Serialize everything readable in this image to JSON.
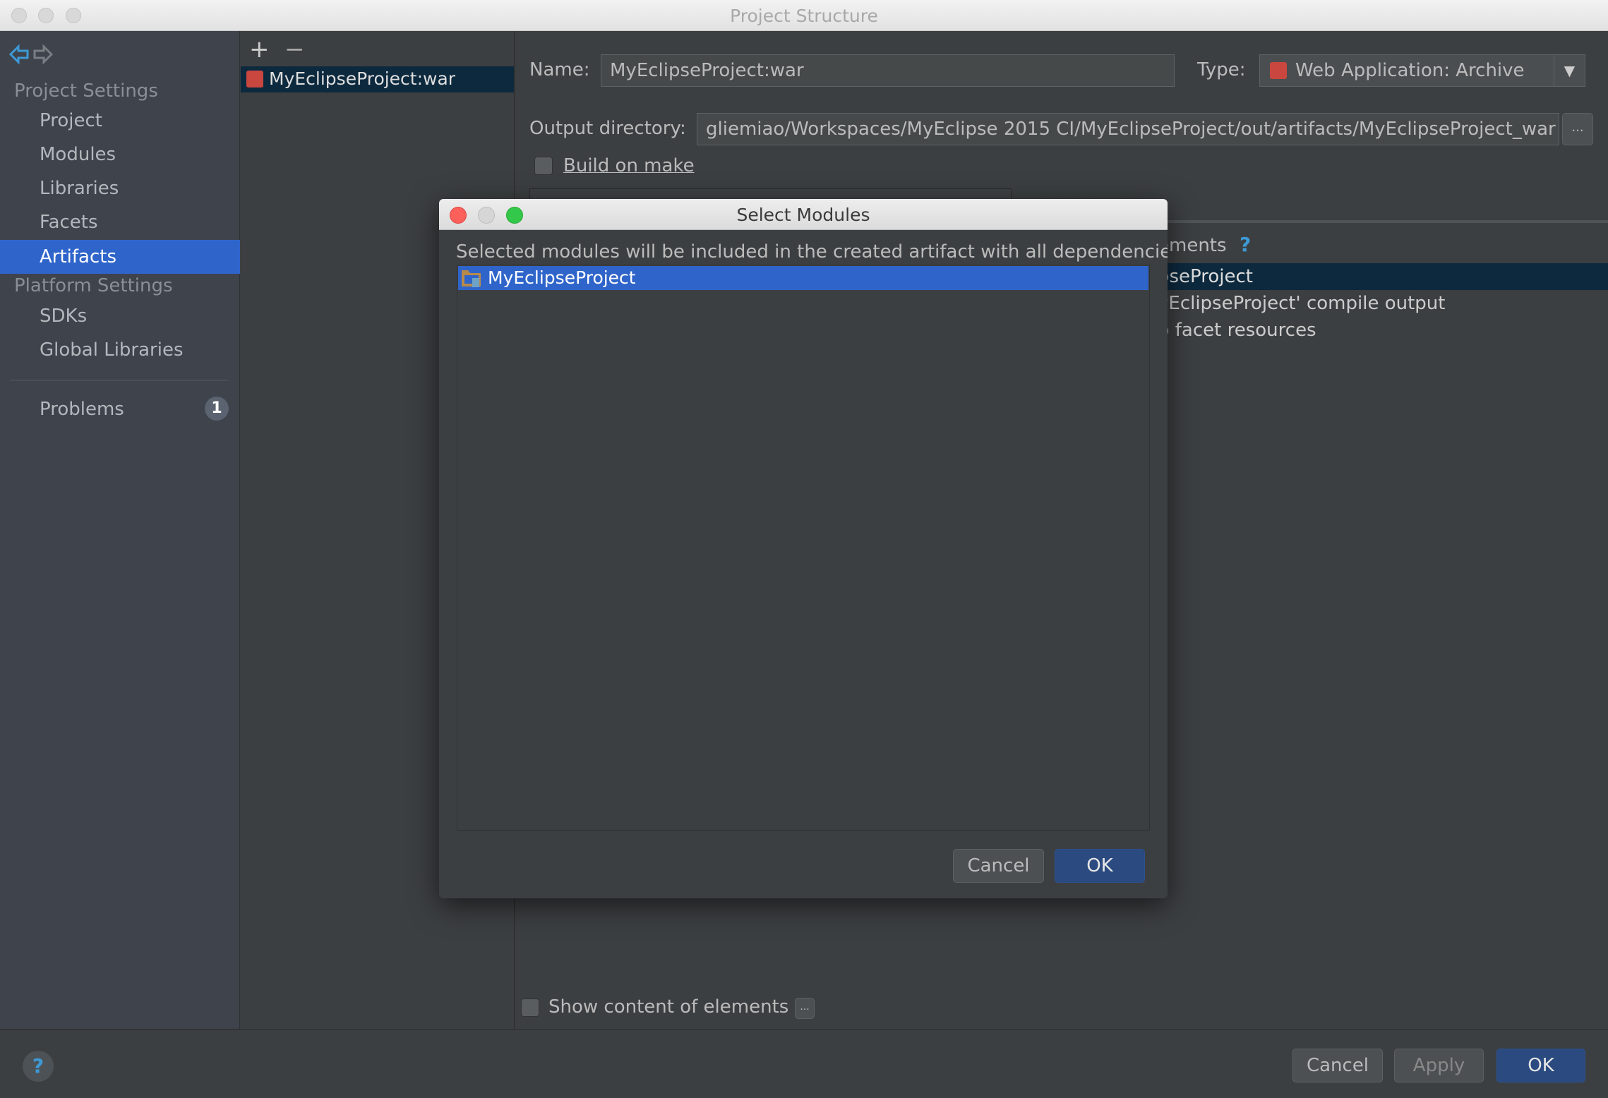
{
  "window": {
    "title": "Project Structure"
  },
  "sidebar": {
    "project_settings": "Project Settings",
    "items": [
      {
        "label": "Project"
      },
      {
        "label": "Modules"
      },
      {
        "label": "Libraries"
      },
      {
        "label": "Facets"
      },
      {
        "label": "Artifacts",
        "selected": true
      }
    ],
    "platform_settings": "Platform Settings",
    "platform_items": [
      {
        "label": "SDKs"
      },
      {
        "label": "Global Libraries"
      }
    ],
    "problems": {
      "label": "Problems",
      "count": "1"
    }
  },
  "artifacts_list": {
    "add": "+",
    "remove": "−",
    "items": [
      {
        "label": "MyEclipseProject:war"
      }
    ]
  },
  "details": {
    "name_label": "Name:",
    "name_value": "MyEclipseProject:war",
    "type_label": "Type:",
    "type_value": "Web Application: Archive",
    "output_label": "Output directory:",
    "output_value": "gliemiao/Workspaces/MyEclipse 2015 CI/MyEclipseProject/out/artifacts/MyEclipseProject_war",
    "browse": "...",
    "build_on_make": "Build on make",
    "elements_header": "ements",
    "help": "?",
    "tree": [
      "pseProject",
      "yEclipseProject' compile output",
      "b facet resources"
    ],
    "show_content": "Show content of elements",
    "show_content_more": "..."
  },
  "footer": {
    "help": "?",
    "cancel": "Cancel",
    "apply": "Apply",
    "ok": "OK"
  },
  "dialog": {
    "title": "Select Modules",
    "description": "Selected modules will be included in the created artifact with all dependencies",
    "modules": [
      {
        "label": "MyEclipseProject",
        "selected": true
      }
    ],
    "cancel": "Cancel",
    "ok": "OK"
  },
  "colors": {
    "selection": "#2f65ca",
    "inactive_selection": "#0d293e",
    "background": "#3c3f41",
    "sidebar": "#3e434c"
  }
}
